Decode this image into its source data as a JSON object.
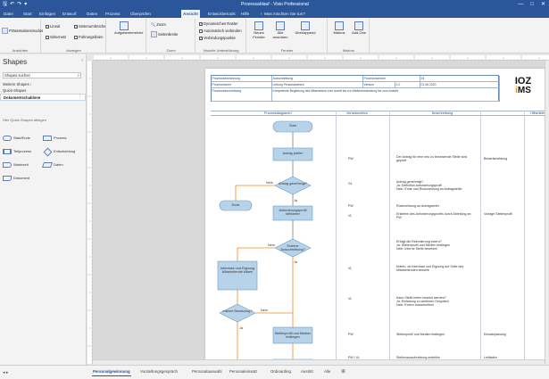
{
  "app": {
    "title": "Prozessablauf - Visio Professional",
    "qat": [
      "save",
      "undo",
      "redo",
      "more"
    ],
    "window_controls": [
      "—",
      "□",
      "✕"
    ]
  },
  "ribbon": {
    "tabs": [
      "Datei",
      "Start",
      "Einfügen",
      "Entwurf",
      "Daten",
      "Prozess",
      "Überprüfen",
      "Ansicht",
      "Entwicklertools",
      "Hilfe",
      "Was möchten Sie tun?"
    ],
    "active_tab": "Ansicht",
    "groups": [
      {
        "name": "Ansichten",
        "items": [
          "Präsentationsmodus"
        ]
      },
      {
        "name": "Anzeigen",
        "items": [
          "Lineal",
          "Seitenumbrüche",
          "Gitternetz",
          "Führungslinien"
        ]
      },
      {
        "name": "Zoom",
        "items": [
          "Zoom",
          "Seitenbreite"
        ]
      },
      {
        "name": "",
        "items": [
          "Aufgabenbereiche"
        ]
      },
      {
        "name": "Visuelle Unterstützung",
        "items": [
          "Dynamisches Raster",
          "Automatisch verbinden",
          "Verbindungspunkte"
        ]
      },
      {
        "name": "Fenster",
        "items": [
          "Neues Fenster",
          "Alle anordnen",
          "Überlappend"
        ]
      },
      {
        "name": "Makros",
        "items": [
          "Makros",
          "Add-Ons"
        ]
      }
    ]
  },
  "shapes_pane": {
    "title": "Shapes",
    "search_value": "Shapes suchen",
    "stencils": [
      "Weitere Shapes",
      "Quick-Shapes"
    ],
    "active_stencil": "Dokumentschablone",
    "drop_hint": "Hier Quick-Shapes ablegen",
    "items": [
      "Start/Ende",
      "Prozess",
      "Teilprozess",
      "Entscheidung",
      "Wartezeit",
      "Daten",
      "Dokument"
    ]
  },
  "header_table": {
    "rows": [
      [
        "Prozessbezeichnung",
        "Ausschreibung",
        "Prozessnummer",
        "24"
      ],
      [
        "Prozessowner",
        "Leitung Personalwesen",
        "Version",
        "1.0",
        "01.06.2020"
      ]
    ],
    "description_label": "Prozessbeschreibung",
    "description_value": "Kompetente Begleitung des Mitarbeiters vom Antritt bis zur Weiterentwicklung bis zum Austritt"
  },
  "logo": {
    "line1": "IOZ",
    "line2_a": "i",
    "line2_b": "MS"
  },
  "columns": [
    "Prozessdiagramm",
    "Verantwortlich",
    "Beschreibung",
    "Hilfsmittel"
  ],
  "flow": {
    "start": "Start",
    "steps": [
      "Antrag prüfen",
      "Anforderungsprofil definieren",
      "Interesse und Eignung Mitarbeitende klären",
      "Stellenprofil und Medien festlegen"
    ],
    "decisions": [
      "Antrag genehmigt?",
      "Externe Ausschreibung?",
      "Interne Besetzung?"
    ],
    "end": "Ende",
    "labels": {
      "nein": "Nein",
      "ja": "Ja"
    }
  },
  "rows": [
    {
      "resp": "PW",
      "desc": "Der Antrag für eine neu zu besetzende Stelle wird geprüft",
      "aid": "Bedarfsmeldung"
    },
    {
      "resp": "GL",
      "desc": "Antrag genehmigt?\nJa: Definition Anforderungsprofil\nNein: Ende und Rückmeldung an Antragsteller",
      "aid": ""
    },
    {
      "resp": "PW",
      "desc": "Rückmeldung an Antragsteller",
      "aid": ""
    },
    {
      "resp": "VL",
      "desc": "Erstellen des Anforderungsprofils durch Abteilung an PW",
      "aid": "Vorlage Stellenprofil"
    },
    {
      "resp": "",
      "desc": "Erfolgt die Rekrutierung extern?\nJa: Stellenprofil und Medien festlegen\nNein: Interne Stelle besetzen",
      "aid": ""
    },
    {
      "resp": "VL",
      "desc": "Klären, ob Interesse und Eignung auf Seite des Mitarbeitenden besteht",
      "aid": ""
    },
    {
      "resp": "VL",
      "desc": "Kann Stelle intern besetzt werden?\nJa: Einladung zu weiterem Gespräch\nNein: Extern ausschreiben",
      "aid": ""
    },
    {
      "resp": "PW",
      "desc": "Stellenprofil und Medien festlegen",
      "aid": "Einsatzplanung"
    },
    {
      "resp": "PW / VL",
      "desc": "Stellenausschreibung erstellen",
      "aid": "Leitfaden"
    }
  ],
  "page_tabs": [
    "Personalgewinnung",
    "Vorstellungsgespräch",
    "Personalauswahl",
    "Personaleinsatz",
    "Onboarding",
    "Austritt",
    "Alle"
  ],
  "active_page": "Personalgewinnung"
}
